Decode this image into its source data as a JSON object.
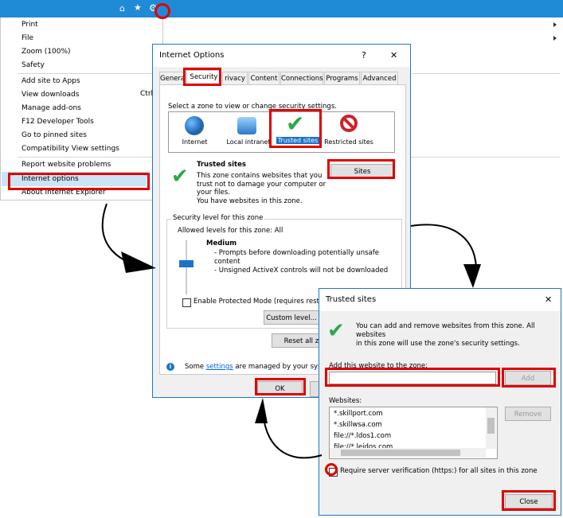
{
  "ie_menu": {
    "items": [
      "Print",
      "File",
      "Zoom (100%)",
      "Safety",
      "Add site to Apps",
      "View downloads",
      "Manage add-ons",
      "F12 Developer Tools",
      "Go to pinned sites",
      "Compatibility View settings",
      "Report website problems",
      "Internet options",
      "About Internet Explorer"
    ],
    "shortcut_view_downloads": "Ctrl",
    "topbar_color": "#1f8ad6"
  },
  "internet_options": {
    "title": "Internet Options",
    "help": "?",
    "close": "✕",
    "tabs": [
      "Genera",
      "Security",
      "rivacy",
      "Content",
      "Connections",
      "Programs",
      "Advanced"
    ],
    "zone_prompt": "Select a zone to view or change security settings.",
    "zones": [
      "Internet",
      "Local intranet",
      "Trusted sites",
      "Restricted sites"
    ],
    "zone_heading": "Trusted sites",
    "zone_desc": [
      "This zone contains websites that you",
      "trust not to damage your computer or",
      "your files.",
      "You have websites in this zone."
    ],
    "sites_button": "Sites",
    "security_level_group": "Security level for this zone",
    "allowed_levels": "Allowed levels for this zone: All",
    "level_name": "Medium",
    "level_desc": [
      "- Prompts before downloading potentially unsafe",
      "content",
      "- Unsigned ActiveX controls will not be downloaded"
    ],
    "protected_mode": "Enable Protected Mode (requires restartin",
    "custom_level": "Custom level...",
    "reset_all": "Reset all zo",
    "info_prefix": "Some",
    "info_link": "settings",
    "info_suffix": "are managed by your syster",
    "ok": "OK"
  },
  "trusted_sites": {
    "title": "Trusted sites",
    "close": "✕",
    "info": [
      "You can add and remove websites from this zone. All websites",
      "in this zone will use the zone's security settings."
    ],
    "add_label": "Add this website to the zone:",
    "add_value": "",
    "add_button": "Add",
    "websites_label": "Websites:",
    "websites": [
      "*.skillport.com",
      "*.skillwsa.com",
      "file://*.ldos1.com",
      "file://*.leidos.com"
    ],
    "remove_button": "Remove",
    "require_https": "Require server verification (https:) for all sites in this zone",
    "close_button": "Close"
  },
  "colors": {
    "highlight": "#e00000",
    "accent": "#1a78c8",
    "check": "#2aa84a"
  }
}
